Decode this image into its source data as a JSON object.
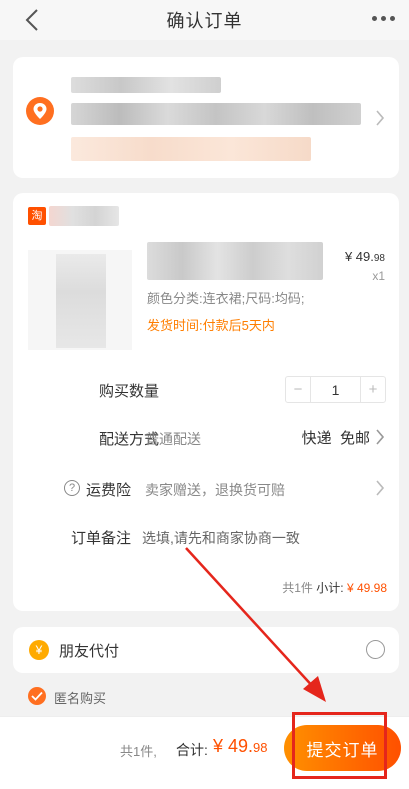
{
  "nav": {
    "title": "确认订单",
    "back_icon": "chevron-left-icon",
    "more_icon": "more-dots-icon"
  },
  "address": {
    "icon": "location-pin-icon",
    "redacted": true
  },
  "order": {
    "shop_badge": "淘",
    "product": {
      "spec": "颜色分类:连衣裙;尺码:均码;",
      "ship_time": "发货时间:付款后5天内",
      "price_main": "¥ 49.",
      "price_cents": "98",
      "qty": "x1"
    },
    "quantity": {
      "label": "购买数量",
      "minus": "−",
      "value": "1",
      "plus": "+"
    },
    "delivery": {
      "label": "配送方式",
      "method": "普通配送",
      "courier": "快递",
      "fee": "免邮"
    },
    "insurance": {
      "label": "运费险",
      "desc": "卖家赠送，退换货可赔"
    },
    "note": {
      "label": "订单备注",
      "placeholder": "选填,请先和商家协商一致"
    },
    "subtotal": {
      "count": "共1件",
      "label": "小计:",
      "amount": "¥ 49.98"
    }
  },
  "friend_pay": {
    "icon_char": "¥",
    "label": "朋友代付"
  },
  "anonymous": {
    "label": "匿名购买",
    "checked": true
  },
  "footer": {
    "count": "共1件,",
    "total_label": "合计:",
    "total_main": "¥ 49.",
    "total_cents": "98",
    "submit": "提交订单"
  },
  "colors": {
    "accent": "#ff5000",
    "orange": "#ff7e00",
    "annotation": "#e5261c"
  }
}
